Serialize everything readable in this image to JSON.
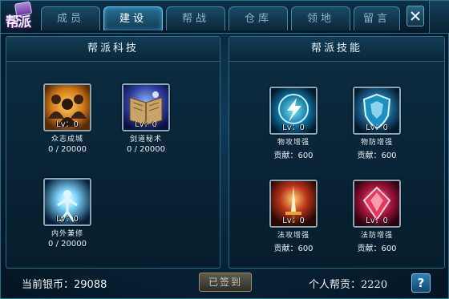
{
  "window": {
    "logo_text": "帮派",
    "tabs": [
      {
        "label": "成员",
        "active": false
      },
      {
        "label": "建设",
        "active": true
      },
      {
        "label": "帮战",
        "active": false
      },
      {
        "label": "仓库",
        "active": false
      },
      {
        "label": "领地",
        "active": false
      },
      {
        "label": "留言",
        "active": false
      }
    ],
    "close_icon": "close-x-icon"
  },
  "tech_panel": {
    "title": "帮派科技",
    "items": [
      {
        "name": "众志成城",
        "level": "Lv：0",
        "progress": "0 / 20000",
        "icon": "crowd-silhouettes-icon"
      },
      {
        "name": "剑道秘术",
        "level": "Lv：0",
        "progress": "0 / 20000",
        "icon": "spell-book-icon"
      },
      {
        "name": "内外兼修",
        "level": "Lv：0",
        "progress": "0 / 20000",
        "icon": "glowing-figure-icon"
      }
    ]
  },
  "skill_panel": {
    "title": "帮派技能",
    "items": [
      {
        "name": "物攻增强",
        "level": "Lv：0",
        "cost": "贡献：600",
        "icon": "lightning-emblem-icon"
      },
      {
        "name": "物防增强",
        "level": "Lv：0",
        "cost": "贡献：600",
        "icon": "shield-emblem-icon"
      },
      {
        "name": "法攻增强",
        "level": "Lv：0",
        "cost": "贡献：600",
        "icon": "fire-sword-icon"
      },
      {
        "name": "法防增强",
        "level": "Lv：0",
        "cost": "贡献：600",
        "icon": "red-crystal-icon"
      }
    ]
  },
  "footer": {
    "silver_label": "当前银币：",
    "silver_value": "29088",
    "signed_button": "已签到",
    "contribution_label": "个人帮贡：",
    "contribution_value": "2220",
    "help_label": "?"
  }
}
